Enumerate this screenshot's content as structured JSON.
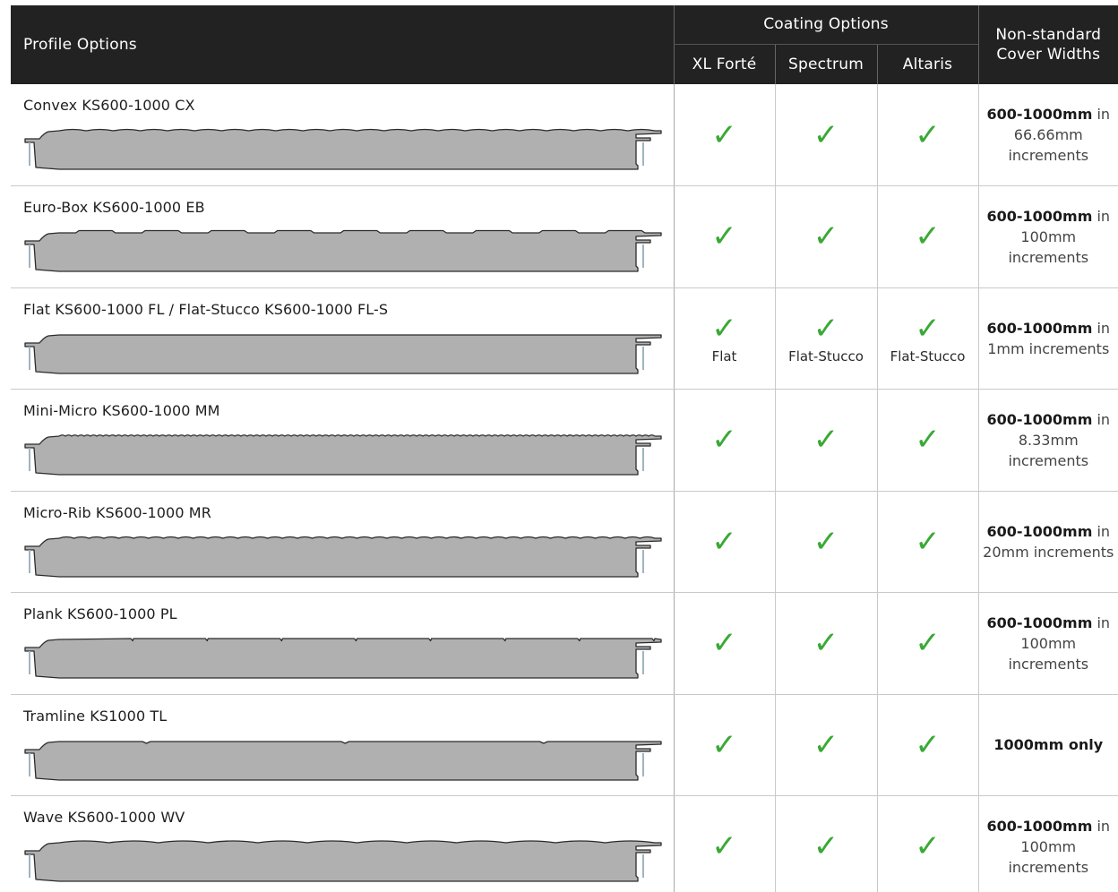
{
  "colors": {
    "header_bg": "#222222",
    "check_green": "#3aa935",
    "panel_fill": "#b0b0b0"
  },
  "header": {
    "profile_options": "Profile Options",
    "coating_options": "Coating Options",
    "coatings": [
      "XL Forté",
      "Spectrum",
      "Altaris"
    ],
    "nonstandard_line1": "Non-standard",
    "nonstandard_line2": "Cover Widths"
  },
  "check_icon": "✓",
  "rows": [
    {
      "name": "Convex KS600-1000 CX",
      "panel_icon": "convex-panel-profile",
      "variants": [
        "",
        "",
        ""
      ],
      "width_strong": "600-1000mm",
      "width_rest": "in 66.66mm increments"
    },
    {
      "name": "Euro-Box KS600-1000 EB",
      "panel_icon": "euro-box-panel-profile",
      "variants": [
        "",
        "",
        ""
      ],
      "width_strong": "600-1000mm",
      "width_rest": "in 100mm increments"
    },
    {
      "name": "Flat KS600-1000 FL / Flat-Stucco KS600-1000 FL-S",
      "panel_icon": "flat-panel-profile",
      "variants": [
        "Flat",
        "Flat-Stucco",
        "Flat-Stucco"
      ],
      "width_strong": "600-1000mm",
      "width_rest": "in 1mm increments"
    },
    {
      "name": "Mini-Micro KS600-1000 MM",
      "panel_icon": "mini-micro-panel-profile",
      "variants": [
        "",
        "",
        ""
      ],
      "width_strong": "600-1000mm",
      "width_rest": "in 8.33mm increments"
    },
    {
      "name": "Micro-Rib KS600-1000 MR",
      "panel_icon": "micro-rib-panel-profile",
      "variants": [
        "",
        "",
        ""
      ],
      "width_strong": "600-1000mm",
      "width_rest": "in 20mm increments"
    },
    {
      "name": "Plank KS600-1000 PL",
      "panel_icon": "plank-panel-profile",
      "variants": [
        "",
        "",
        ""
      ],
      "width_strong": "600-1000mm",
      "width_rest": "in 100mm increments"
    },
    {
      "name": "Tramline KS1000 TL",
      "panel_icon": "tramline-panel-profile",
      "variants": [
        "",
        "",
        ""
      ],
      "width_strong": "1000mm only",
      "width_rest": ""
    },
    {
      "name": "Wave KS600-1000 WV",
      "panel_icon": "wave-panel-profile",
      "variants": [
        "",
        "",
        ""
      ],
      "width_strong": "600-1000mm",
      "width_rest": "in 100mm increments"
    }
  ]
}
